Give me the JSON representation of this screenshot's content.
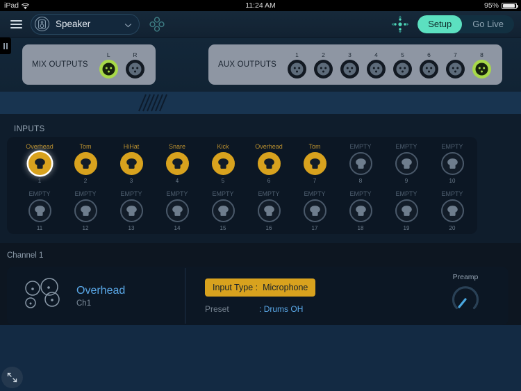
{
  "status_bar": {
    "carrier": "iPad",
    "wifi_icon": "wifi-icon",
    "time": "11:24 AM",
    "battery_percent": "95%",
    "battery_icon": "battery-icon"
  },
  "navbar": {
    "menu_icon": "hamburger-icon",
    "device": {
      "icon": "speaker-icon",
      "name": "Speaker",
      "chevron": "chevron-down-icon"
    },
    "dots_icon": "four-dot-cluster-icon",
    "pan_icon": "pan-arrows-icon",
    "segments": [
      {
        "label": "Setup",
        "active": true
      },
      {
        "label": "Go Live",
        "active": false
      }
    ]
  },
  "colors": {
    "accent_gold": "#d8a21e",
    "accent_teal": "#5ce0c0",
    "accent_blue": "#5aa8e8",
    "jack_active_green": "#a7d949",
    "panel_grey": "#8e96a3"
  },
  "outputs": {
    "mix": {
      "label": "MIX OUTPUTS",
      "jacks": [
        {
          "num": "L",
          "active": true
        },
        {
          "num": "R",
          "active": false
        }
      ]
    },
    "aux": {
      "label": "AUX OUTPUTS",
      "jacks": [
        {
          "num": "1",
          "active": false
        },
        {
          "num": "2",
          "active": false
        },
        {
          "num": "3",
          "active": false
        },
        {
          "num": "4",
          "active": false
        },
        {
          "num": "5",
          "active": false
        },
        {
          "num": "6",
          "active": false
        },
        {
          "num": "7",
          "active": false
        },
        {
          "num": "8",
          "active": true
        }
      ]
    }
  },
  "inputs": {
    "title": "INPUTS",
    "empty_label": "EMPTY",
    "items": [
      {
        "num": "1",
        "name": "Overhead",
        "active": true,
        "selected": true
      },
      {
        "num": "2",
        "name": "Tom",
        "active": true,
        "selected": false
      },
      {
        "num": "3",
        "name": "HiHat",
        "active": true,
        "selected": false
      },
      {
        "num": "4",
        "name": "Snare",
        "active": true,
        "selected": false
      },
      {
        "num": "5",
        "name": "Kick",
        "active": true,
        "selected": false
      },
      {
        "num": "6",
        "name": "Overhead",
        "active": true,
        "selected": false
      },
      {
        "num": "7",
        "name": "Tom",
        "active": true,
        "selected": false
      },
      {
        "num": "8",
        "name": "EMPTY",
        "active": false,
        "selected": false
      },
      {
        "num": "9",
        "name": "EMPTY",
        "active": false,
        "selected": false
      },
      {
        "num": "10",
        "name": "EMPTY",
        "active": false,
        "selected": false
      },
      {
        "num": "11",
        "name": "EMPTY",
        "active": false,
        "selected": false
      },
      {
        "num": "12",
        "name": "EMPTY",
        "active": false,
        "selected": false
      },
      {
        "num": "13",
        "name": "EMPTY",
        "active": false,
        "selected": false
      },
      {
        "num": "14",
        "name": "EMPTY",
        "active": false,
        "selected": false
      },
      {
        "num": "15",
        "name": "EMPTY",
        "active": false,
        "selected": false
      },
      {
        "num": "16",
        "name": "EMPTY",
        "active": false,
        "selected": false
      },
      {
        "num": "17",
        "name": "EMPTY",
        "active": false,
        "selected": false
      },
      {
        "num": "18",
        "name": "EMPTY",
        "active": false,
        "selected": false
      },
      {
        "num": "19",
        "name": "EMPTY",
        "active": false,
        "selected": false
      },
      {
        "num": "20",
        "name": "EMPTY",
        "active": false,
        "selected": false
      }
    ]
  },
  "channel": {
    "section_label": "Channel 1",
    "icon": "drum-kit-overhead-icon",
    "name": "Overhead",
    "sub": "Ch1",
    "input_type_label": "Input Type :",
    "input_type_value": "Microphone",
    "preset_label": "Preset",
    "preset_separator": ":",
    "preset_value": "Drums OH",
    "preamp_label": "Preamp",
    "preamp_knob": "preamp-knob"
  },
  "footer": {
    "expand_icon": "expand-collapse-icon"
  }
}
